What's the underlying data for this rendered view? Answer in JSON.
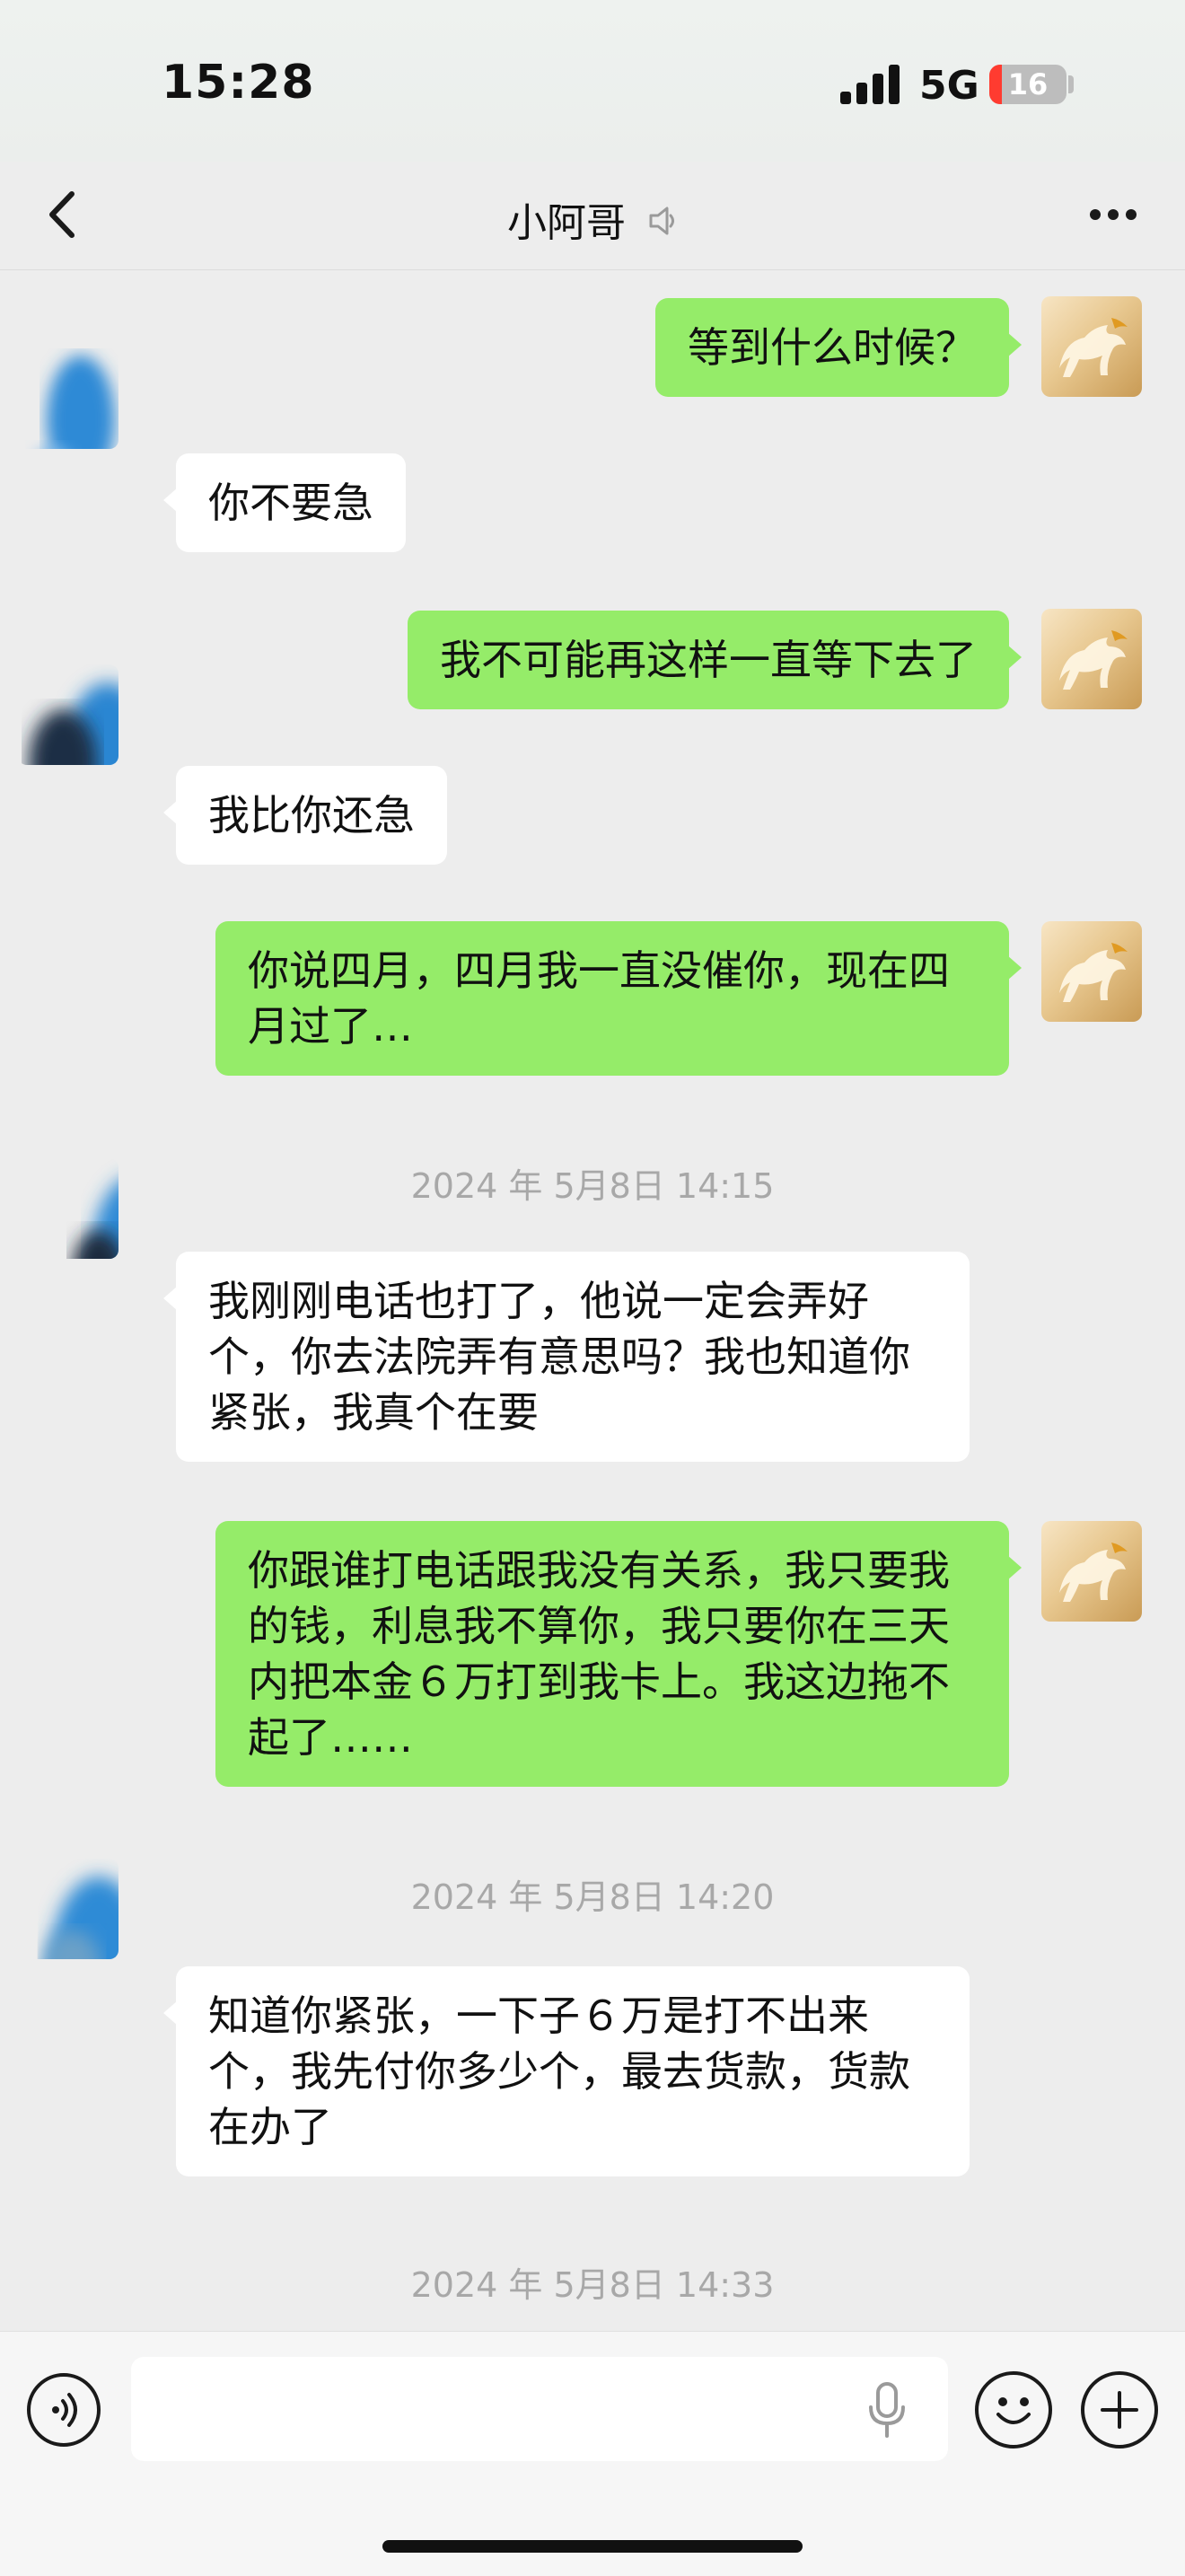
{
  "status_bar": {
    "time": "15:28",
    "network": "5G",
    "battery": "16",
    "battery_level": 0.16
  },
  "nav": {
    "title": "小阿哥",
    "back_icon": "chevron-left-icon",
    "speaker_icon": "speaker-muted-icon",
    "more_icon": "more-dots-icon"
  },
  "messages": [
    {
      "from": "me",
      "text": "等到什么时候？"
    },
    {
      "from": "other",
      "text": "你不要急"
    },
    {
      "from": "me",
      "text": "我不可能再这样一直等下去了"
    },
    {
      "from": "other",
      "text": "我比你还急"
    },
    {
      "from": "me",
      "text": "你说四月，四月我一直没催你，现在四月过了…"
    },
    {
      "from": "other",
      "text": "我刚刚电话也打了，他说一定会弄好个，你去法院弄有意思吗？我也知道你紧张，我真个在要"
    },
    {
      "from": "me",
      "text": "你跟谁打电话跟我没有关系，我只要我的钱，利息我不算你，我只要你在三天内把本金６万打到我卡上。我这边拖不起了……"
    },
    {
      "from": "other",
      "text": "知道你紧张，一下子６万是打不出来个，我先付你多少个，最去货款，货款在办了"
    }
  ],
  "timestamps": [
    "2024 年 5月8日 14:15",
    "2024 年 5月8日 14:20",
    "2024 年 5月8日 14:33"
  ],
  "input_bar": {
    "placeholder": "",
    "voice_icon": "voice-mode-icon",
    "mic_icon": "microphone-icon",
    "emoji_icon": "emoji-icon",
    "plus_icon": "plus-icon"
  },
  "colors": {
    "outgoing_bubble": "#95ec69",
    "incoming_bubble": "#ffffff",
    "background": "#ededed",
    "battery_low": "#ff3b30"
  }
}
